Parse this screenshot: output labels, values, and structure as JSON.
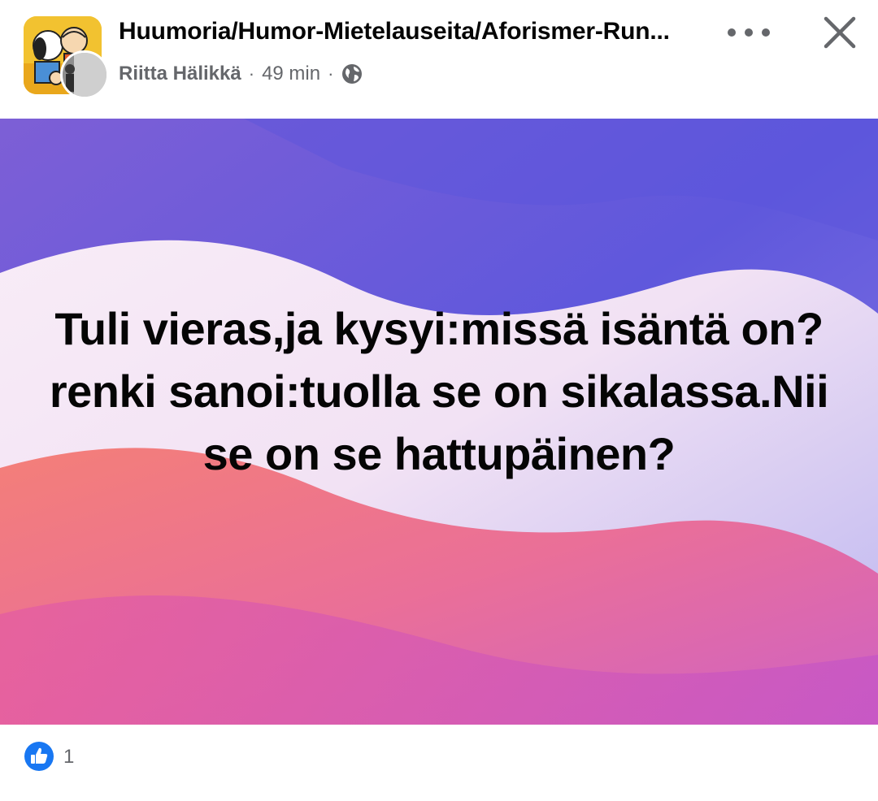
{
  "post_header": {
    "group_name": "Huumoria/Humor-Mietelauseita/Aforismer-Run...",
    "author": "Riitta Hälikkä",
    "separator": "·",
    "time": "49 min",
    "privacy_icon": "globe-icon",
    "more_icon": "more-options-icon",
    "close_icon": "close-icon"
  },
  "post": {
    "text": "Tuli vieras,ja kysyi:missä isäntä on?renki sanoi:tuolla se on sikalassa.Nii se on se hattupäinen?",
    "background_colors": [
      "#6b5bd8",
      "#f3e6f6",
      "#f27a8a",
      "#d95fb3"
    ]
  },
  "reactions": {
    "icon": "like-icon",
    "count": "1",
    "accent": "#1877f2"
  }
}
